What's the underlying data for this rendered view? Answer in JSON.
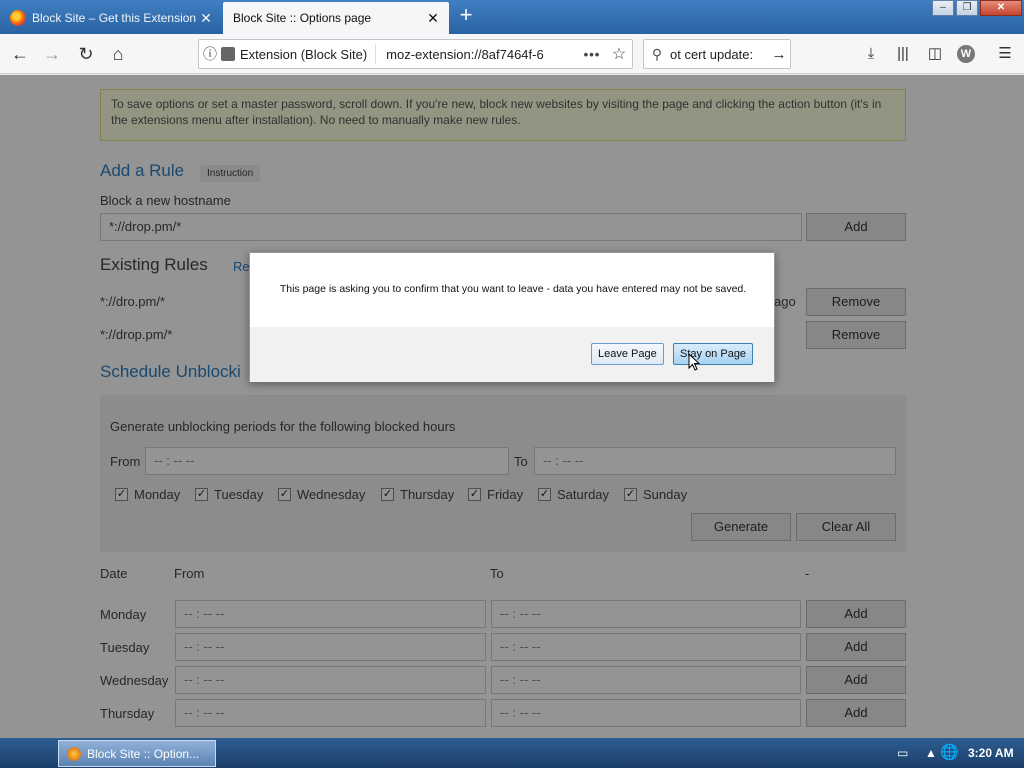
{
  "tabs": [
    {
      "title": "Block Site – Get this Extension f",
      "active": false
    },
    {
      "title": "Block Site :: Options page",
      "active": true
    }
  ],
  "navbar": {
    "url_identity": "Extension (Block Site)",
    "url": "moz-extension://8af7464f-6",
    "search_value": "ot cert update:"
  },
  "page": {
    "notice": "To save options or set a master password, scroll down. If you're new, block new websites by visiting the page and clicking the action button (it's in the extensions menu after installation). No need to manually make new rules.",
    "add_rule_heading": "Add a Rule",
    "instruction_badge": "Instruction",
    "block_hostname_label": "Block a new hostname",
    "hostname_value": "*://drop.pm/*",
    "add_label": "Add",
    "existing_rules_heading": "Existing Rules",
    "existing_rules_link": "Re",
    "rules": [
      {
        "pattern": "*://dro.pm/*",
        "remove_label": "Remove",
        "age": "ago"
      },
      {
        "pattern": "*://drop.pm/*",
        "remove_label": "Remove"
      }
    ],
    "schedule_heading": "Schedule Unblocki",
    "generate_text": "Generate unblocking periods for the following blocked hours",
    "from_label": "From",
    "to_label": "To",
    "time_placeholder": "-- : --   --",
    "days": [
      "Monday",
      "Tuesday",
      "Wednesday",
      "Thursday",
      "Friday",
      "Saturday",
      "Sunday"
    ],
    "generate_label": "Generate",
    "clear_all_label": "Clear All",
    "table_headers": {
      "date": "Date",
      "from": "From",
      "to": "To",
      "dash": "-"
    },
    "schedule_rows": [
      "Monday",
      "Tuesday",
      "Wednesday",
      "Thursday"
    ]
  },
  "dialog": {
    "message": "This page is asking you to confirm that you want to leave - data you have entered may not be saved.",
    "leave_label": "Leave Page",
    "stay_label": "Stay on Page"
  },
  "taskbar": {
    "item_title": "Block Site :: Option...",
    "clock": "3:20 AM"
  }
}
